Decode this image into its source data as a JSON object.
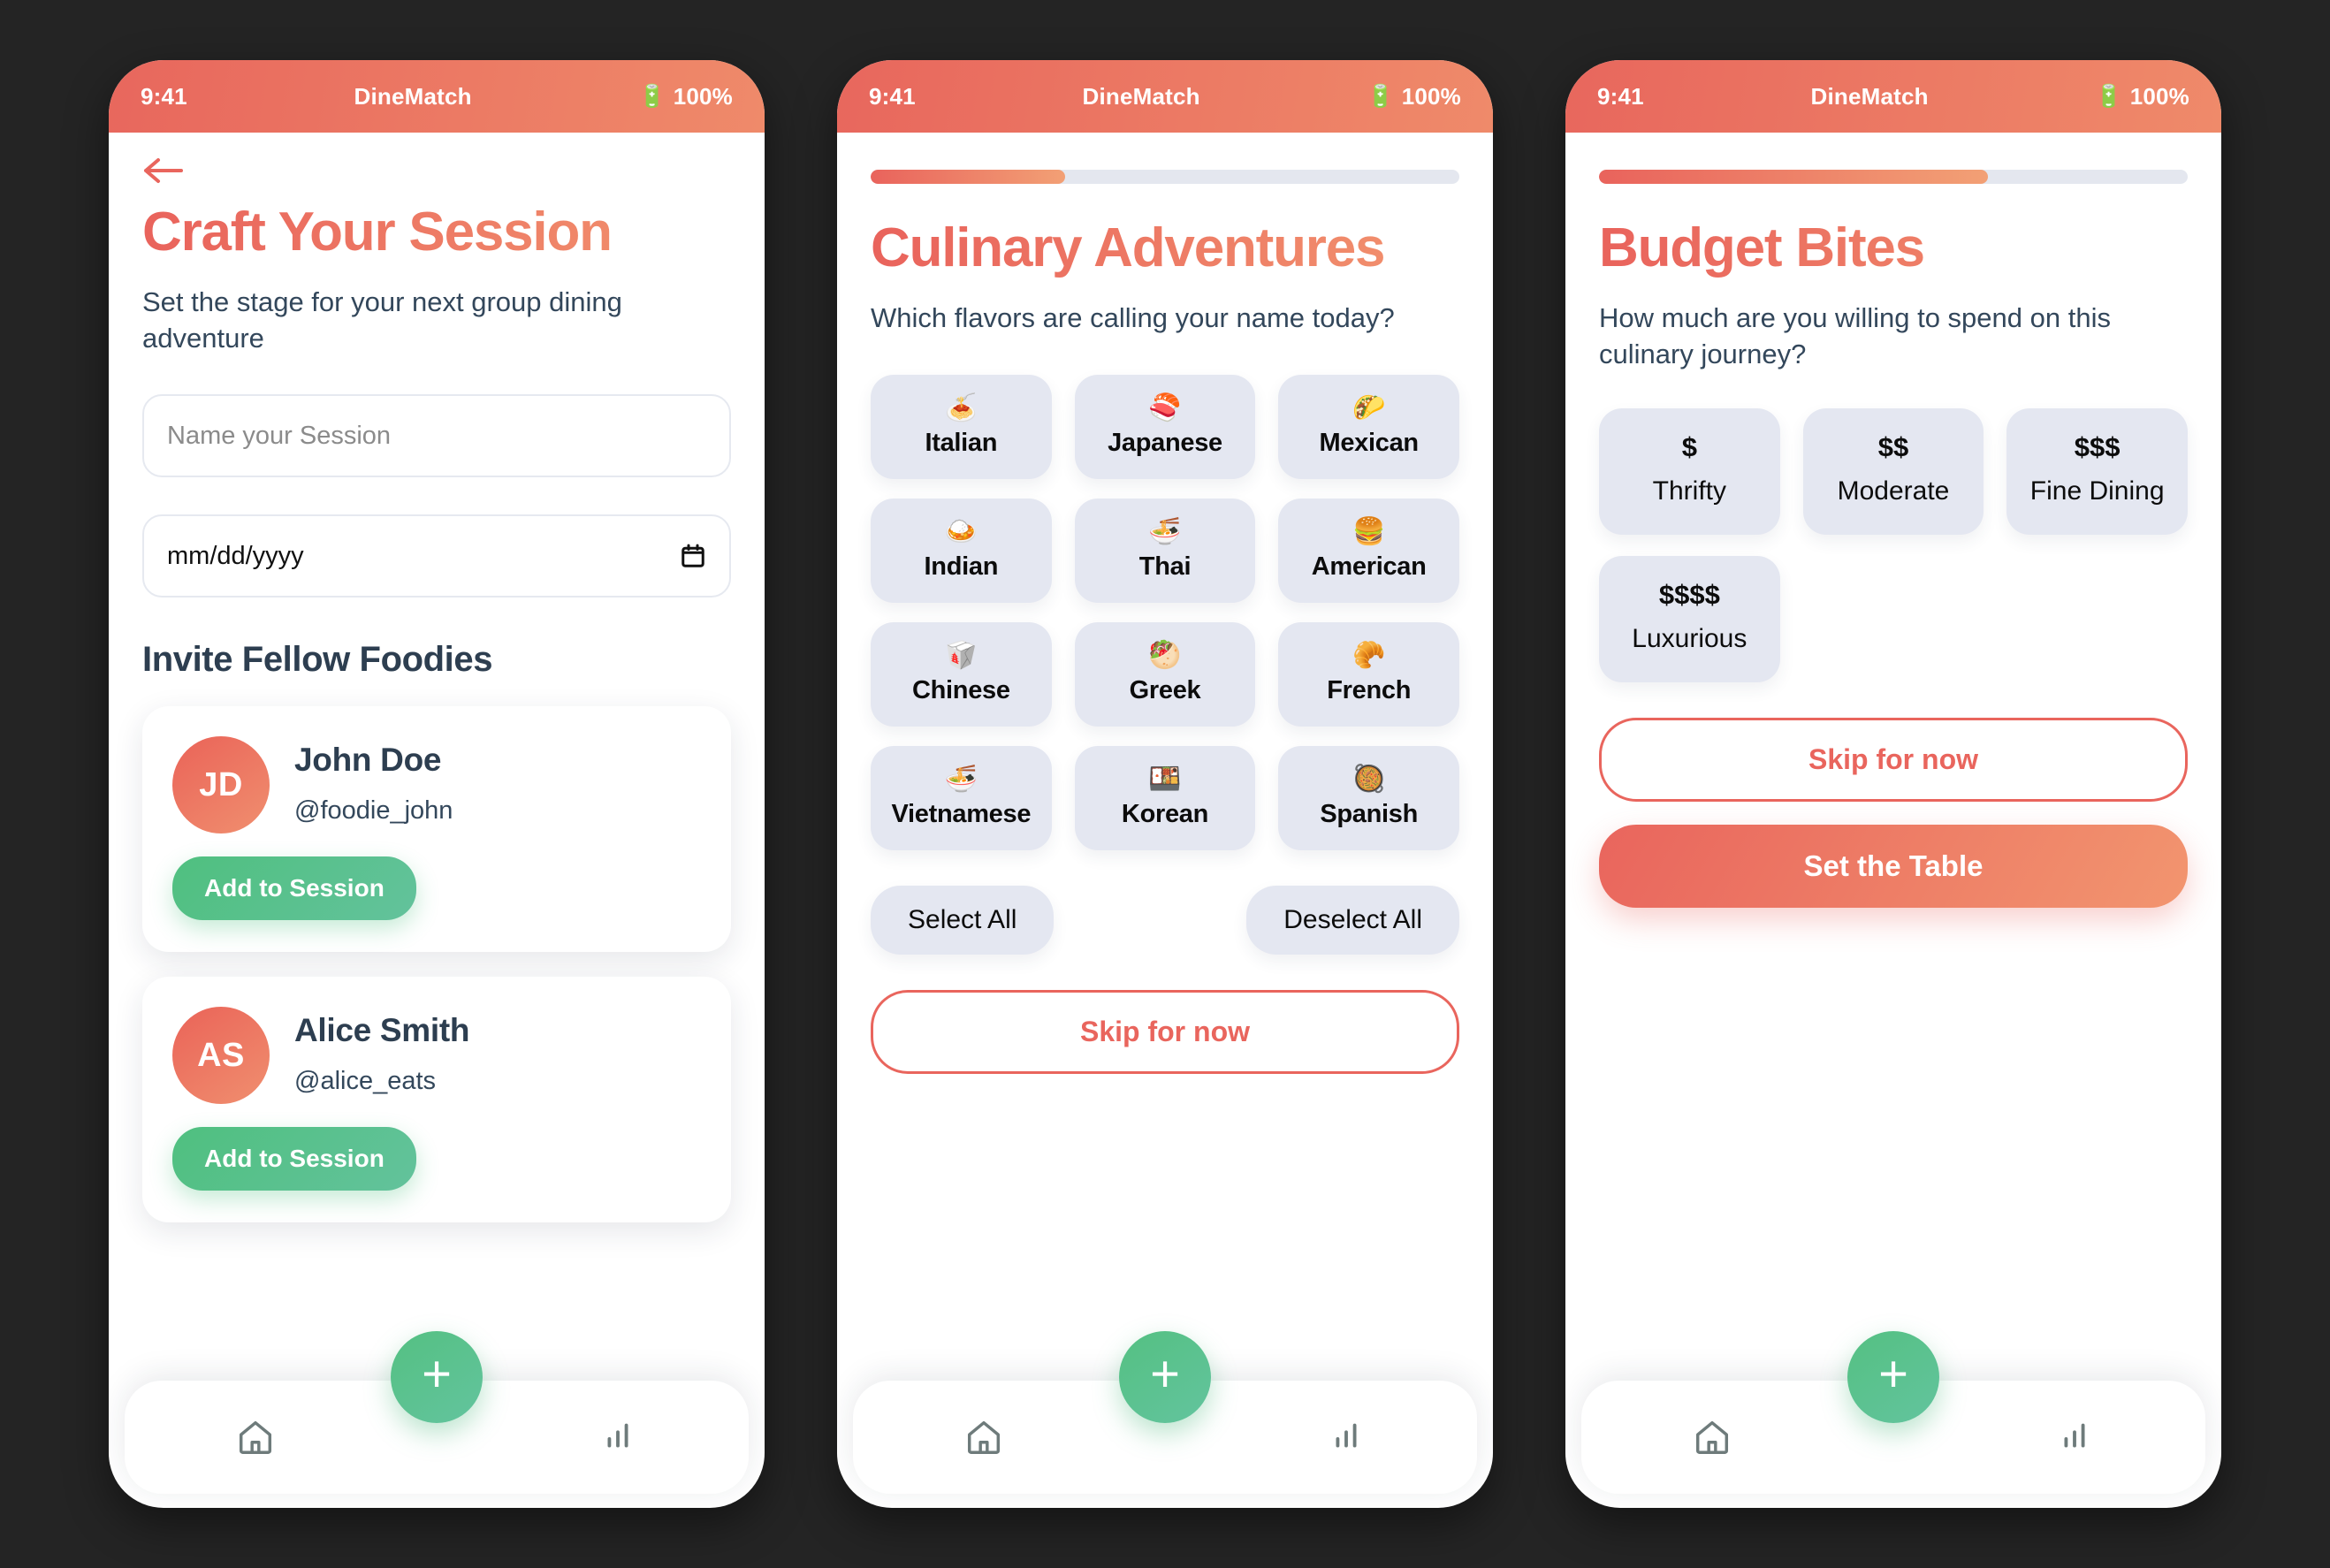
{
  "app": {
    "name": "DineMatch",
    "time": "9:41",
    "battery": "100%",
    "battery_icon": "battery-icon"
  },
  "theme": {
    "accent_start": "#e9635c",
    "accent_end": "#f2936e",
    "green": "#4fc07f",
    "tile_bg": "#e4e7f1",
    "text_dark": "#2d3e50"
  },
  "screens": [
    {
      "id": "craft-session",
      "title": "Craft Your Session",
      "subtitle": "Set the stage for your next group dining adventure",
      "back_icon": "back-arrow-icon",
      "inputs": {
        "session_name_placeholder": "Name your Session",
        "date_value": "mm/dd/yyyy",
        "date_icon": "calendar-icon"
      },
      "section_heading": "Invite Fellow Foodies",
      "friends": [
        {
          "initials": "JD",
          "name": "John Doe",
          "handle": "@foodie_john",
          "action": "Add to Session"
        },
        {
          "initials": "AS",
          "name": "Alice Smith",
          "handle": "@alice_eats",
          "action": "Add to Session"
        }
      ]
    },
    {
      "id": "culinary-adventures",
      "title": "Culinary Adventures",
      "subtitle": "Which flavors are calling your name today?",
      "progress": 33,
      "cuisines": [
        {
          "emoji": "🍝",
          "icon_name": "spaghetti-icon",
          "label": "Italian"
        },
        {
          "emoji": "🍣",
          "icon_name": "sushi-icon",
          "label": "Japanese"
        },
        {
          "emoji": "🌮",
          "icon_name": "taco-icon",
          "label": "Mexican"
        },
        {
          "emoji": "🍛",
          "icon_name": "curry-rice-icon",
          "label": "Indian"
        },
        {
          "emoji": "🍜",
          "icon_name": "noodle-bowl-icon",
          "label": "Thai"
        },
        {
          "emoji": "🍔",
          "icon_name": "hamburger-icon",
          "label": "American"
        },
        {
          "emoji": "🥡",
          "icon_name": "takeout-box-icon",
          "label": "Chinese"
        },
        {
          "emoji": "🥙",
          "icon_name": "stuffed-flatbread-icon",
          "label": "Greek"
        },
        {
          "emoji": "🥐",
          "icon_name": "croissant-icon",
          "label": "French"
        },
        {
          "emoji": "🍜",
          "icon_name": "noodle-bowl-icon",
          "label": "Vietnamese"
        },
        {
          "emoji": "🍱",
          "icon_name": "bento-box-icon",
          "label": "Korean"
        },
        {
          "emoji": "🥘",
          "icon_name": "shallow-pan-icon",
          "label": "Spanish"
        }
      ],
      "select_all": "Select All",
      "deselect_all": "Deselect All",
      "skip": "Skip for now"
    },
    {
      "id": "budget-bites",
      "title": "Budget Bites",
      "subtitle": "How much are you willing to spend on this culinary journey?",
      "progress": 66,
      "budgets": [
        {
          "symbol": "$",
          "label": "Thrifty"
        },
        {
          "symbol": "$$",
          "label": "Moderate"
        },
        {
          "symbol": "$$$",
          "label": "Fine Dining"
        },
        {
          "symbol": "$$$$",
          "label": "Luxurious"
        }
      ],
      "skip": "Skip for now",
      "primary": "Set the Table"
    }
  ],
  "bottom_nav": {
    "home_icon": "home-icon",
    "stats_icon": "bar-chart-icon",
    "fab_icon": "plus-icon",
    "fab_label": "+"
  }
}
